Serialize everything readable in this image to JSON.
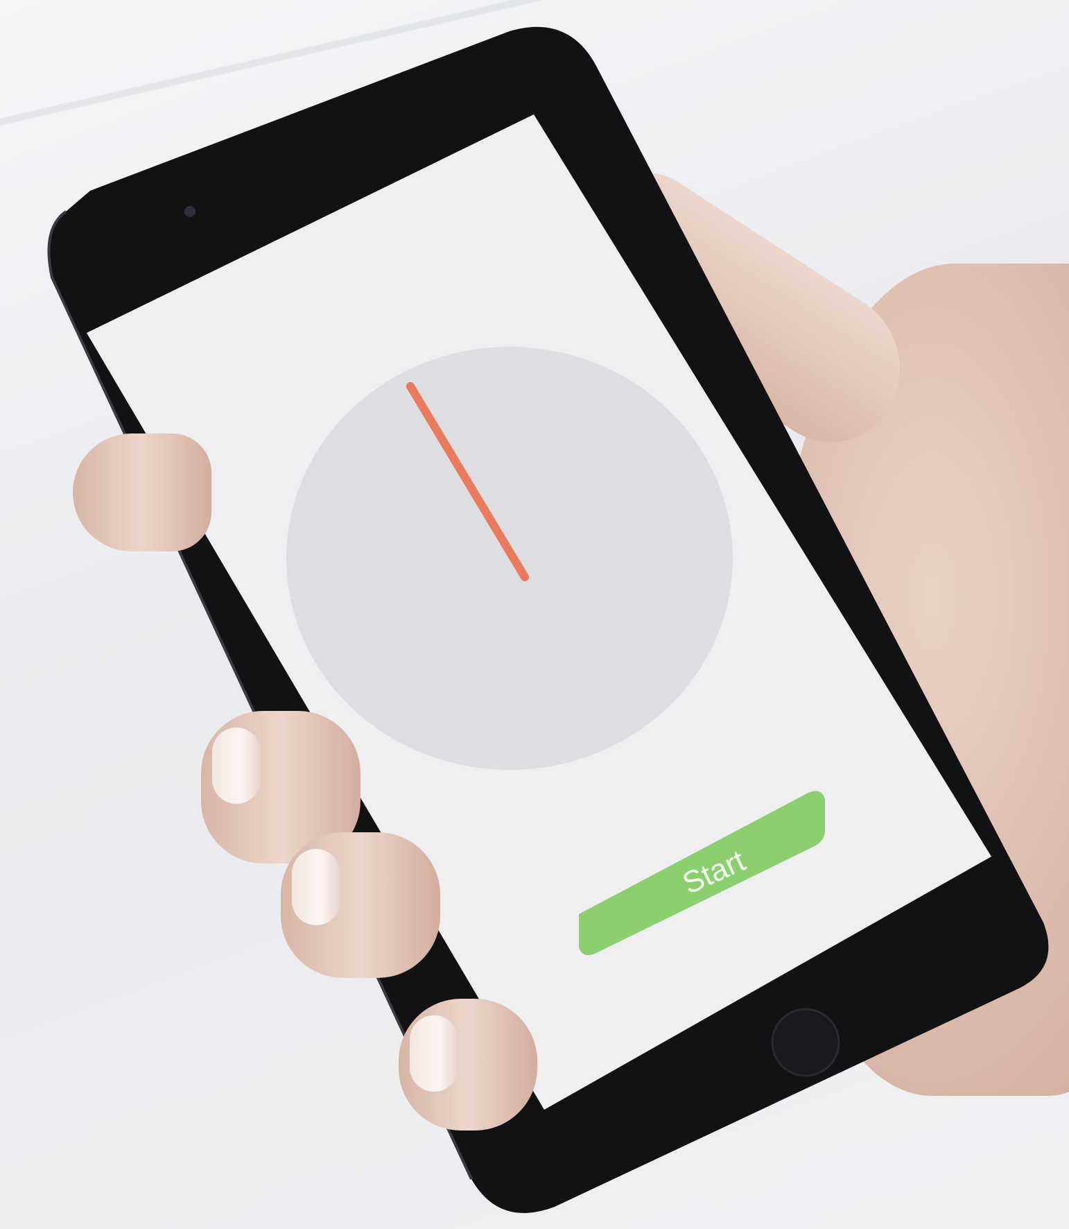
{
  "app": {
    "start_button_label": "Start"
  },
  "colors": {
    "needle": "#e97a5d",
    "start_button": "#8ccf6e",
    "dial": "#dcdee1",
    "screen": "#efeff1",
    "phone_body": "#121214"
  },
  "icons": {
    "dial": "gauge-dial",
    "needle": "gauge-needle"
  }
}
